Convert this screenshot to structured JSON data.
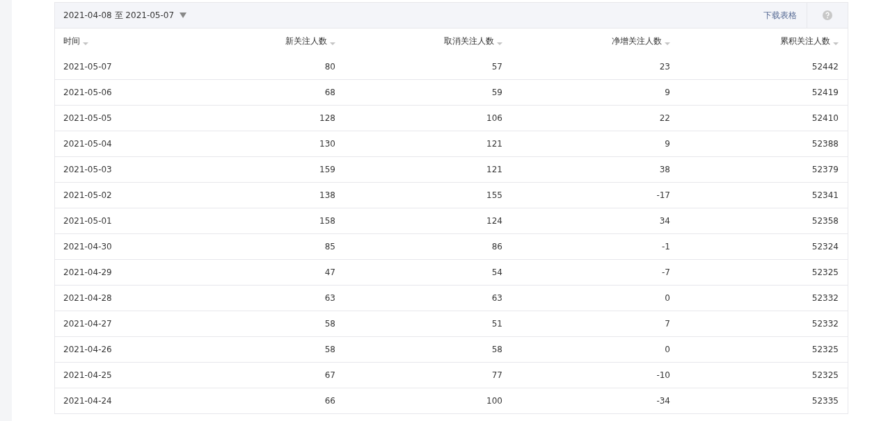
{
  "date_range": "2021-04-08 至 2021-05-07",
  "download_link": "下载表格",
  "table": {
    "columns": [
      "时间",
      "新关注人数",
      "取消关注人数",
      "净增关注人数",
      "累积关注人数"
    ],
    "rows": [
      [
        "2021-05-07",
        "80",
        "57",
        "23",
        "52442"
      ],
      [
        "2021-05-06",
        "68",
        "59",
        "9",
        "52419"
      ],
      [
        "2021-05-05",
        "128",
        "106",
        "22",
        "52410"
      ],
      [
        "2021-05-04",
        "130",
        "121",
        "9",
        "52388"
      ],
      [
        "2021-05-03",
        "159",
        "121",
        "38",
        "52379"
      ],
      [
        "2021-05-02",
        "138",
        "155",
        "-17",
        "52341"
      ],
      [
        "2021-05-01",
        "158",
        "124",
        "34",
        "52358"
      ],
      [
        "2021-04-30",
        "85",
        "86",
        "-1",
        "52324"
      ],
      [
        "2021-04-29",
        "47",
        "54",
        "-7",
        "52325"
      ],
      [
        "2021-04-28",
        "63",
        "63",
        "0",
        "52332"
      ],
      [
        "2021-04-27",
        "58",
        "51",
        "7",
        "52332"
      ],
      [
        "2021-04-26",
        "58",
        "58",
        "0",
        "52325"
      ],
      [
        "2021-04-25",
        "67",
        "77",
        "-10",
        "52325"
      ],
      [
        "2021-04-24",
        "66",
        "100",
        "-34",
        "52335"
      ]
    ]
  }
}
